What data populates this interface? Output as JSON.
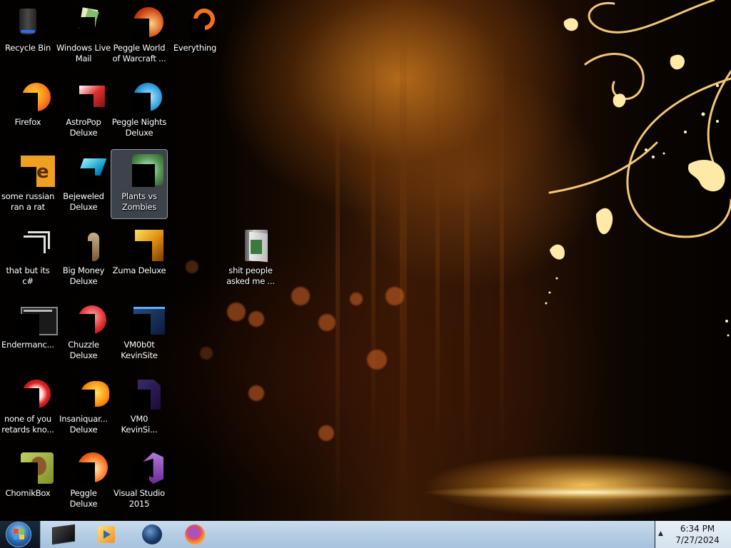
{
  "desktop": {
    "icons": [
      {
        "label": "Recycle Bin",
        "icon": "recycle-bin-icon"
      },
      {
        "label": "Windows Live\nMail",
        "icon": "mail-icon"
      },
      {
        "label": "Peggle World\nof Warcraft ...",
        "icon": "peggle-wow-icon"
      },
      {
        "label": "Everything",
        "icon": "everything-search-icon"
      },
      {
        "label": "Firefox",
        "icon": "firefox-icon"
      },
      {
        "label": "AstroPop\nDeluxe",
        "icon": "astropop-icon"
      },
      {
        "label": "Peggle Nights\nDeluxe",
        "icon": "peggle-nights-icon"
      },
      {
        "label": "some russian\nran a rat",
        "icon": "document-icon"
      },
      {
        "label": "Bejeweled\nDeluxe",
        "icon": "bejeweled-icon"
      },
      {
        "label": "Plants vs\nZombies",
        "icon": "plants-vs-zombies-icon"
      },
      {
        "label": "that but its c#",
        "icon": "copy-icon"
      },
      {
        "label": "Big Money\nDeluxe",
        "icon": "big-money-icon"
      },
      {
        "label": "Zuma Deluxe",
        "icon": "zuma-icon"
      },
      {
        "label": "shit people\nasked me ...",
        "icon": "folder-icon"
      },
      {
        "label": "Endermanc...",
        "icon": "terminal-icon"
      },
      {
        "label": "Chuzzle\nDeluxe",
        "icon": "chuzzle-icon"
      },
      {
        "label": "VM0b0t\nKevinSite",
        "icon": "vm-folder-icon"
      },
      {
        "label": "none of you\nretards kno...",
        "icon": "app-icon"
      },
      {
        "label": "Insaniquar...\nDeluxe",
        "icon": "insaniquarium-icon"
      },
      {
        "label": "VM0\nKevinSi...",
        "icon": "vm-file-icon"
      },
      {
        "label": "ChomikBox",
        "icon": "chomikbox-icon"
      },
      {
        "label": "Peggle Deluxe",
        "icon": "peggle-icon"
      },
      {
        "label": "Visual Studio\n2015",
        "icon": "visual-studio-icon"
      }
    ],
    "selected_icon": "Plants vs\nZombies"
  },
  "taskbar": {
    "start_icon": "windows-start-icon",
    "pinned": [
      "window-app-icon",
      "media-player-icon",
      "globe-icon",
      "firefox-icon"
    ],
    "tray_arrow": "▲",
    "time": "6:34 PM",
    "date": "7/27/2024"
  },
  "colors": {
    "taskbar": "#b5cde4",
    "wallpaper_gold": "#f0b030"
  }
}
